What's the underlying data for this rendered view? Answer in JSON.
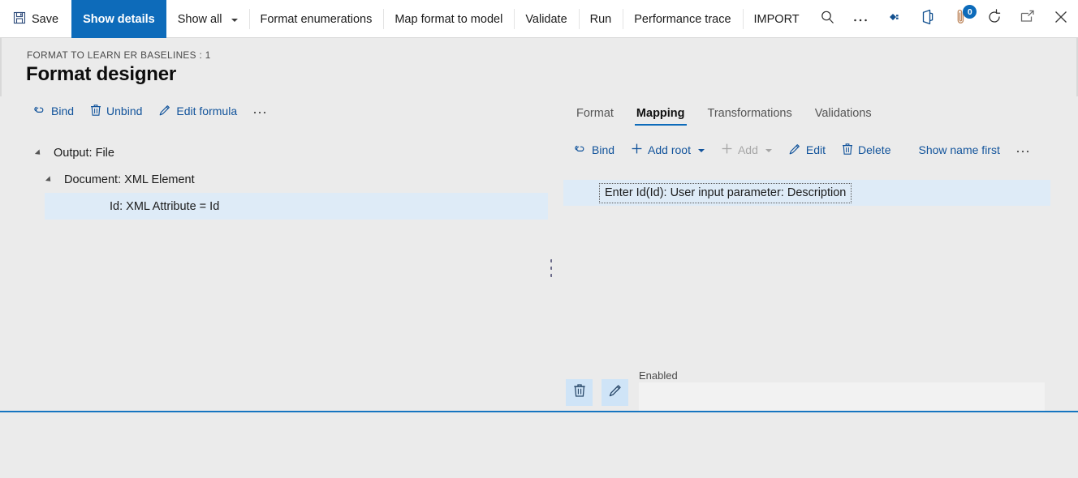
{
  "colors": {
    "accent": "#0d6bba",
    "link": "#11539b",
    "selection": "#deebf7",
    "background": "#ebebeb",
    "bar": "#ffffff",
    "disabled": "#a6a6a6"
  },
  "topbar": {
    "commands": [
      {
        "label": "Save",
        "icon": "save-icon",
        "active": false,
        "separator": false
      },
      {
        "label": "Show details",
        "icon": null,
        "active": true,
        "separator": false
      },
      {
        "label": "Show all",
        "icon": null,
        "active": false,
        "separator": false,
        "caret": true
      },
      {
        "label": "Format enumerations",
        "icon": null,
        "active": false,
        "separator": true
      },
      {
        "label": "Map format to model",
        "icon": null,
        "active": false,
        "separator": true
      },
      {
        "label": "Validate",
        "icon": null,
        "active": false,
        "separator": true
      },
      {
        "label": "Run",
        "icon": null,
        "active": false,
        "separator": true
      },
      {
        "label": "Performance trace",
        "icon": null,
        "active": false,
        "separator": true
      },
      {
        "label": "IMPORT",
        "icon": null,
        "active": false,
        "separator": true
      }
    ],
    "icon_buttons": [
      {
        "name": "search-icon",
        "badge": null
      },
      {
        "name": "more-options-icon",
        "badge": null
      },
      {
        "name": "diamond-connector-icon",
        "badge": null
      },
      {
        "name": "office-app-icon",
        "badge": null
      },
      {
        "name": "attachments-icon",
        "badge": "0"
      },
      {
        "name": "refresh-icon",
        "badge": null
      },
      {
        "name": "popout-icon",
        "badge": null
      },
      {
        "name": "close-icon",
        "badge": null
      }
    ]
  },
  "header": {
    "breadcrumb": "FORMAT TO LEARN ER BASELINES : 1",
    "title": "Format designer"
  },
  "left_pane": {
    "toolbar": [
      {
        "label": "Bind",
        "icon": "bind-link-icon",
        "disabled": false
      },
      {
        "label": "Unbind",
        "icon": "trash-icon",
        "disabled": false
      },
      {
        "label": "Edit formula",
        "icon": "pencil-icon",
        "disabled": false
      },
      {
        "label": "…",
        "icon": "overflow-icon",
        "disabled": false
      }
    ],
    "tree": [
      {
        "label": "Output: File",
        "depth": 0,
        "expanded": true,
        "selected": false
      },
      {
        "label": "Document: XML Element",
        "depth": 1,
        "expanded": true,
        "selected": false
      },
      {
        "label": "Id: XML Attribute = Id",
        "depth": 2,
        "expanded": false,
        "selected": true
      }
    ]
  },
  "right_pane": {
    "tabs": [
      {
        "label": "Format",
        "active": false
      },
      {
        "label": "Mapping",
        "active": true
      },
      {
        "label": "Transformations",
        "active": false
      },
      {
        "label": "Validations",
        "active": false
      }
    ],
    "toolbar": [
      {
        "label": "Bind",
        "icon": "bind-link-icon",
        "disabled": false,
        "caret": false
      },
      {
        "label": "Add root",
        "icon": "plus-icon",
        "disabled": false,
        "caret": true
      },
      {
        "label": "Add",
        "icon": "plus-icon",
        "disabled": true,
        "caret": true
      },
      {
        "label": "Edit",
        "icon": "pencil-icon",
        "disabled": false,
        "caret": false
      },
      {
        "label": "Delete",
        "icon": "trash-icon",
        "disabled": false,
        "caret": false
      },
      {
        "label": "Show name first",
        "icon": null,
        "disabled": false,
        "caret": false
      },
      {
        "label": "…",
        "icon": "overflow-icon",
        "disabled": false,
        "caret": false
      }
    ],
    "items": [
      {
        "label": "Enter Id(Id): User input parameter: Description",
        "selected": true,
        "focused": true
      }
    ],
    "detail_form": {
      "delete_button": "trash-icon",
      "edit_button": "pencil-icon",
      "field_label": "Enabled",
      "field_value": "",
      "field_placeholder": ""
    }
  }
}
